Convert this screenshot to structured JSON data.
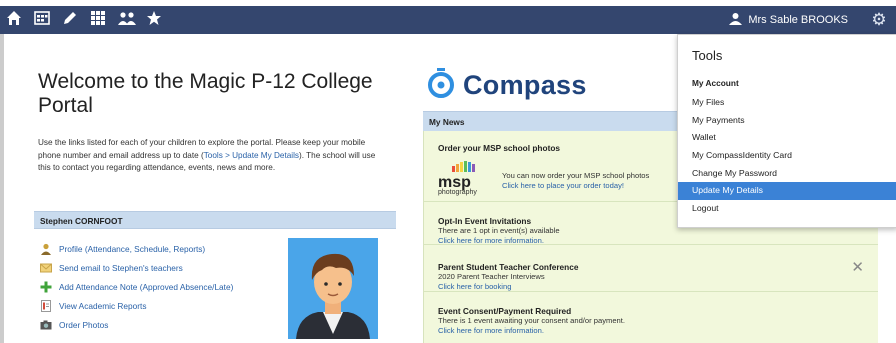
{
  "topbar": {
    "nav_icons": [
      "home-icon",
      "calendar-icon",
      "pencil-icon",
      "grid-icon",
      "people-icon",
      "star-icon"
    ],
    "user_name": "Mrs Sable BROOKS",
    "bg_color": "#34466e"
  },
  "welcome": {
    "title": "Welcome to the Magic P-12 College Portal",
    "intro_1": "Use the links listed for each of your children to explore the portal. Please keep your mobile phone number and email address up to date (",
    "intro_link": "Tools > Update My Details",
    "intro_2": "). The school will use this to contact you regarding attendance, events, news and more."
  },
  "student": {
    "name": "Stephen CORNFOOT",
    "links": [
      {
        "label": "Profile (Attendance, Schedule, Reports)",
        "icon": "profile-icon"
      },
      {
        "label": "Send email to Stephen's teachers",
        "icon": "email-icon"
      },
      {
        "label": "Add Attendance Note (Approved Absence/Late)",
        "icon": "plus-icon"
      },
      {
        "label": "View Academic Reports",
        "icon": "report-icon"
      },
      {
        "label": "Order Photos",
        "icon": "camera-icon"
      }
    ]
  },
  "compass": {
    "logo_text": "Compass",
    "news_header": "My News",
    "msp_logo": "msp",
    "msp_logo_sub": "photography",
    "cards": [
      {
        "title": "Order your MSP school photos",
        "desc": "You can now order your MSP school photos",
        "click": "Click here to place your order today!"
      },
      {
        "title": "Opt-In Event Invitations",
        "desc": "There are 1 opt in event(s) available",
        "click": "Click here for more information."
      },
      {
        "title": "Parent Student Teacher Conference",
        "desc": "2020 Parent Teacher Interviews",
        "click": "Click here for booking"
      },
      {
        "title": "Event Consent/Payment Required",
        "desc": "There is 1 event awaiting your consent and/or payment.",
        "click": "Click here for more information."
      }
    ]
  },
  "menu": {
    "title": "Tools",
    "section": "My Account",
    "items": [
      "My Files",
      "My Payments",
      "Wallet",
      "My CompassIdentity Card",
      "Change My Password",
      "Update My Details",
      "Logout"
    ],
    "active_index": 5
  },
  "colors": {
    "accent": "#3b82d6",
    "link": "#2a62a8",
    "header_band": "#c9dbee",
    "news_card": "#f2f8dc"
  }
}
